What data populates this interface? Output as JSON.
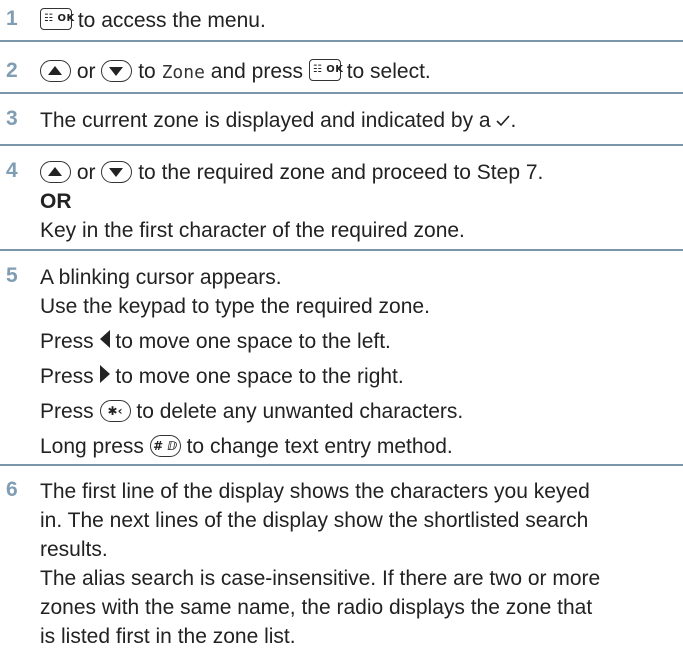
{
  "colors": {
    "step_number": "#7f9db3",
    "divider": "#7a96ab",
    "text": "#222222"
  },
  "icons": {
    "menu_ok_key": "menu-ok-key-icon",
    "up_key": "up-navigation-key-icon",
    "down_key": "down-navigation-key-icon",
    "left_key": "left-arrow-key-icon",
    "right_key": "right-arrow-key-icon",
    "star_key": "star-delete-key-icon",
    "hash_key": "hash-key-icon",
    "check": "check-mark-icon"
  },
  "keys": {
    "menu_ok": "☷ OK",
    "star": "✱‹",
    "hash": "# ⅅ"
  },
  "steps": [
    {
      "number": "1",
      "text": "to access the menu."
    },
    {
      "number": "2",
      "or": "or",
      "to": "to",
      "zone": "Zone",
      "and_press": "and press",
      "select": "to select."
    },
    {
      "number": "3",
      "text": "The current zone is displayed and indicated by a",
      "period": "."
    },
    {
      "number": "4",
      "or": "or",
      "text": "to the required zone and proceed to Step 7.",
      "or_label": "OR",
      "alt_text": "Key in the first character of the required zone."
    },
    {
      "number": "5",
      "line1": "A blinking cursor appears.",
      "line2": "Use the keypad to type the required zone.",
      "press": "Press",
      "left_text": "to move one space to the left.",
      "right_text": "to move one space to the right.",
      "delete_text": "to delete any unwanted characters.",
      "long_press": "Long press",
      "entry_text": "to change text entry method."
    },
    {
      "number": "6",
      "lines": [
        "The first line of the display shows the characters you keyed",
        "in. The next lines of the display show the shortlisted search",
        "results.",
        "The alias search is case-insensitive. If there are two or more",
        "zones with the same name, the radio displays the zone that",
        "is listed first in the zone list."
      ]
    }
  ]
}
